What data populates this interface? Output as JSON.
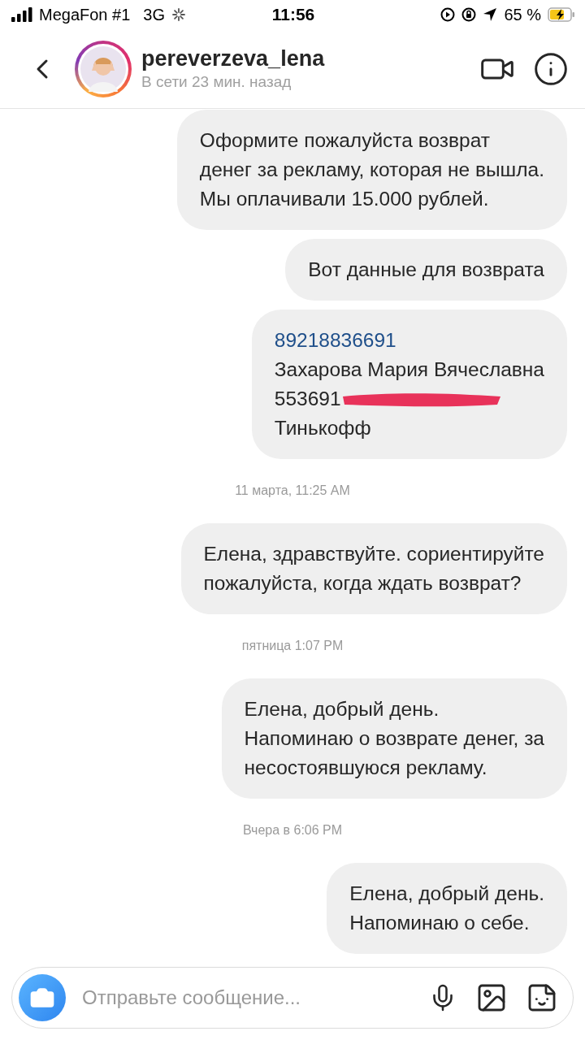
{
  "status_bar": {
    "carrier": "MegaFon #1",
    "network": "3G",
    "time": "11:56",
    "battery": "65 %"
  },
  "header": {
    "username": "pereverzeva_lena",
    "status": "В сети 23 мин. назад"
  },
  "messages": [
    {
      "kind": "message",
      "lines": [
        {
          "kind": "text",
          "text": "Оформите пожалуйста возврат"
        },
        {
          "kind": "text",
          "text": "денег за рекламу, которая не вышла."
        },
        {
          "kind": "text",
          "text": "Мы оплачивали 15.000 рублей."
        }
      ]
    },
    {
      "kind": "message",
      "lines": [
        {
          "kind": "text",
          "text": "Вот данные для возврата"
        }
      ]
    },
    {
      "kind": "message",
      "lines": [
        {
          "kind": "link",
          "text": "89218836691"
        },
        {
          "kind": "text",
          "text": "Захарова Мария Вячеславна"
        },
        {
          "kind": "redacted",
          "text": "553691"
        },
        {
          "kind": "text",
          "text": "Тинькофф"
        }
      ]
    },
    {
      "kind": "timestamp",
      "text": "11 марта, 11:25 AM"
    },
    {
      "kind": "message",
      "lines": [
        {
          "kind": "text",
          "text": "Елена, здравствуйте. сориентируйте"
        },
        {
          "kind": "text",
          "text": "пожалуйста, когда ждать возврат?"
        }
      ]
    },
    {
      "kind": "timestamp",
      "text": "пятница 1:07 PM"
    },
    {
      "kind": "message",
      "lines": [
        {
          "kind": "text",
          "text": "Елена, добрый день."
        },
        {
          "kind": "text",
          "text": "Напоминаю о возврате денег, за"
        },
        {
          "kind": "text",
          "text": "несостоявшуюся рекламу."
        }
      ]
    },
    {
      "kind": "timestamp",
      "text": "Вчера в 6:06 PM"
    },
    {
      "kind": "message",
      "lines": [
        {
          "kind": "text",
          "text": "Елена, добрый день."
        },
        {
          "kind": "text",
          "text": "Напоминаю о себе."
        }
      ]
    }
  ],
  "composer": {
    "placeholder": "Отправьте сообщение..."
  }
}
